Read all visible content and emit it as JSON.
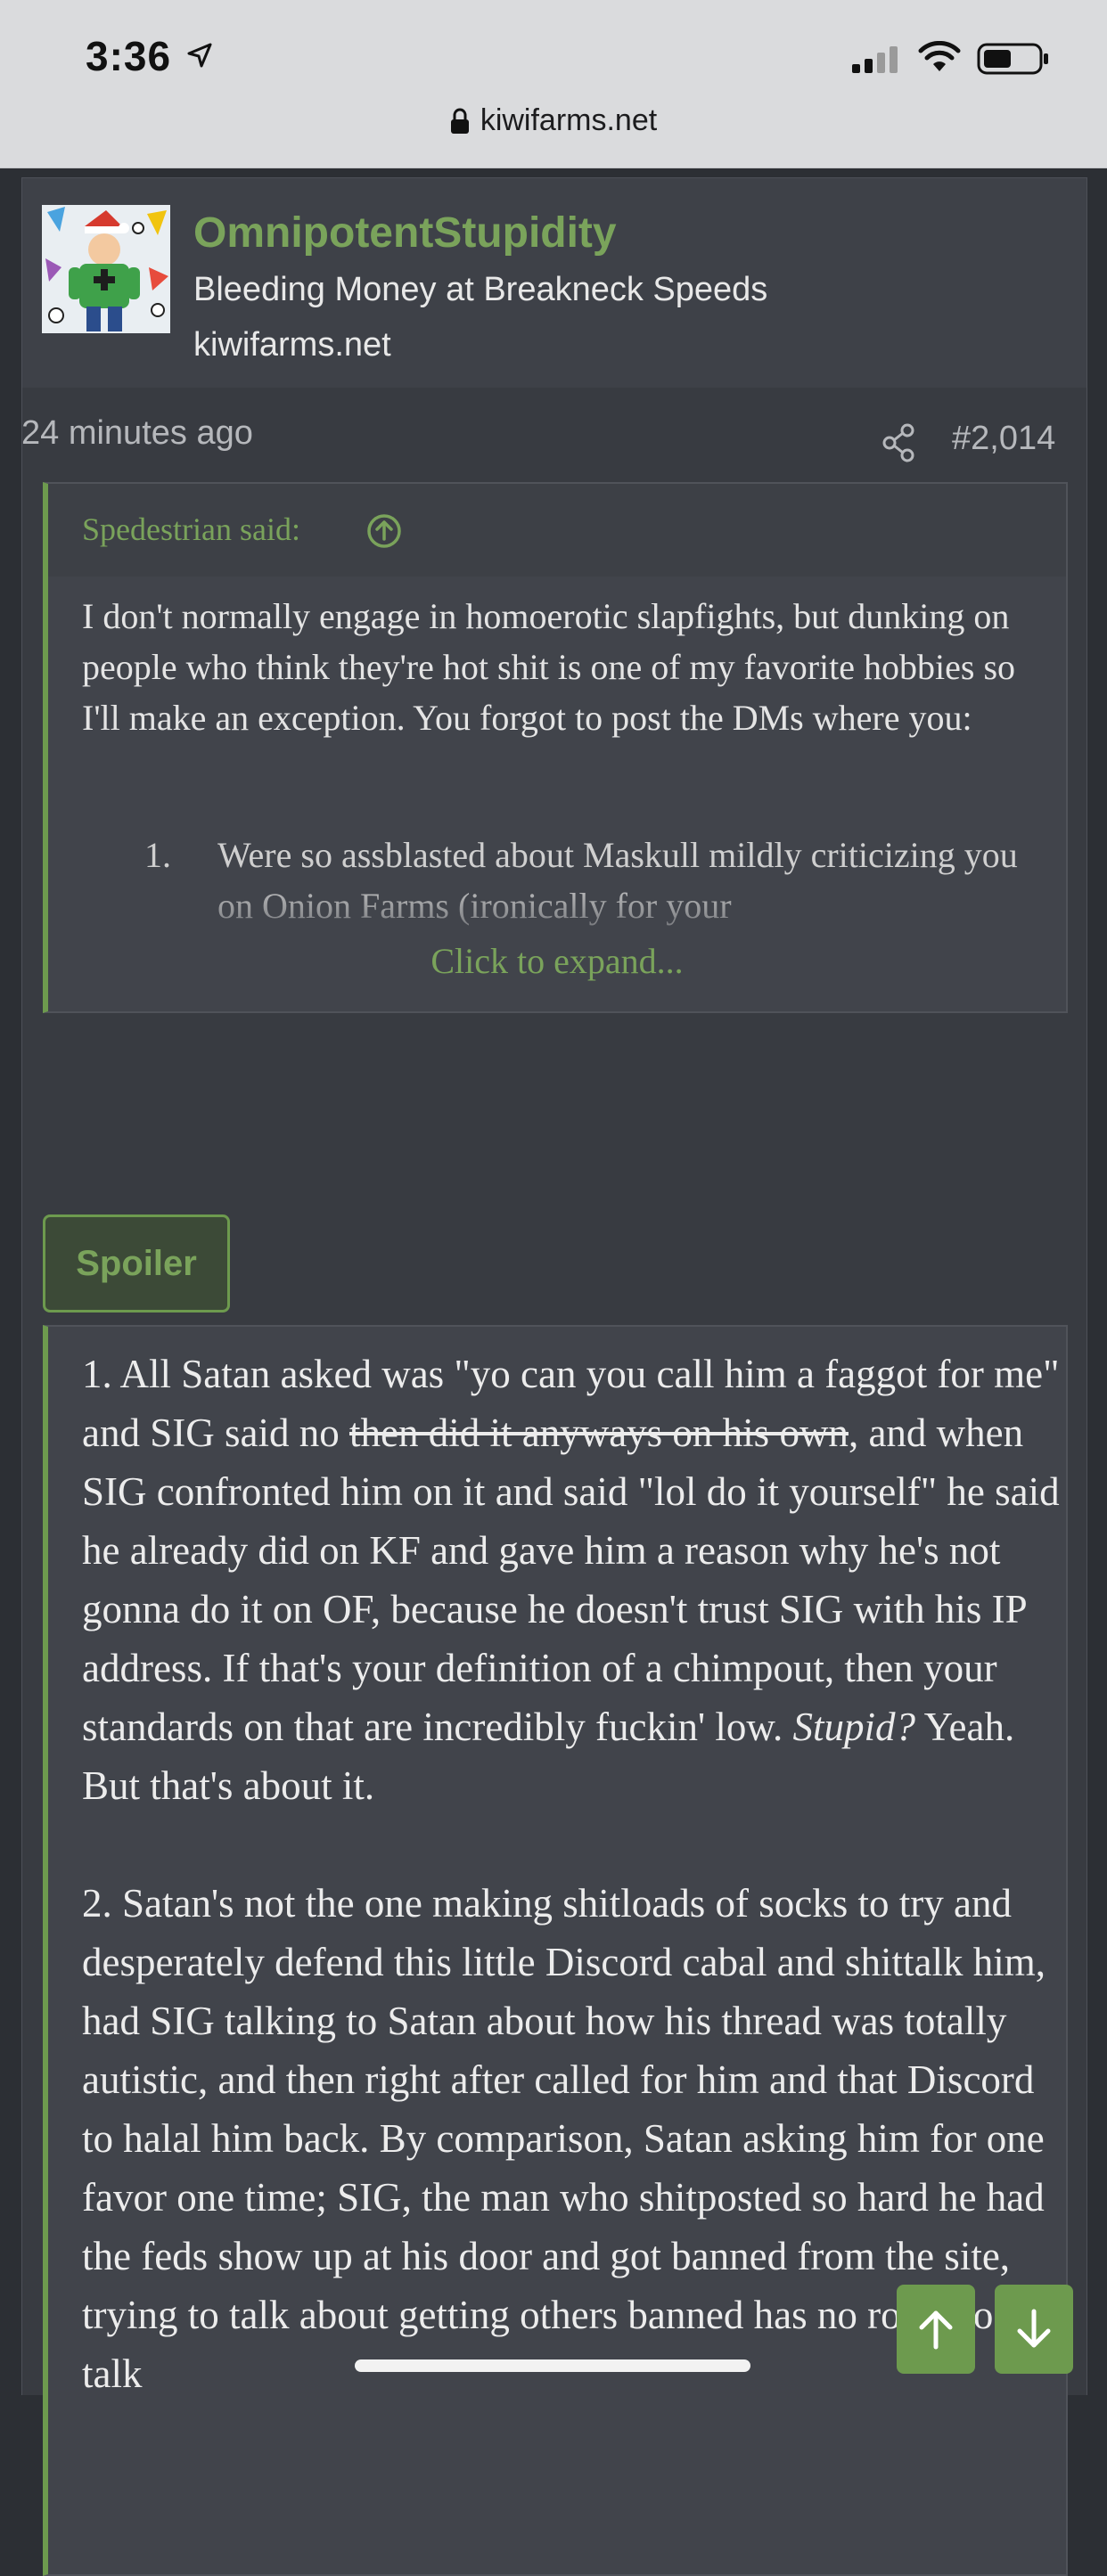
{
  "status_bar": {
    "time": "3:36",
    "url": "kiwifarms.net"
  },
  "user_card": {
    "username": "OmnipotentStupidity",
    "title": "Bleeding Money at Breakneck Speeds",
    "site": "kiwifarms.net"
  },
  "post": {
    "time": "24 minutes ago",
    "number": "#2,014"
  },
  "quote": {
    "attribution": "Spedestrian said:",
    "body": "I don't normally engage in homoerotic slapfights, but dunking on people who think they're hot shit is one of my favorite hobbies so I'll make an exception. You forgot to post the DMs where you:",
    "list_number": "1.",
    "list_text": "Were so assblasted about Maskull mildly criticizing you on Onion Farms (ironically for your",
    "expand_label": "Click to expand..."
  },
  "spoiler": {
    "button_label": "Spoiler",
    "p1_a": "1. All Satan asked was \"yo can you call him a faggot for me\" and SIG said no ",
    "p1_strike": "then did it anyways on his own",
    "p1_b": ", and when SIG confronted him on it and said \"lol do it yourself\" he said he already did on KF and gave him a reason why he's not gonna do it on OF, because he doesn't trust SIG with his IP address. If that's your definition of a chimpout, then your standards on that are incredibly fuckin' low. ",
    "p1_italic": "Stupid?",
    "p1_c": " Yeah. But that's about it.",
    "p2": "2. Satan's not the one making shitloads of socks to try and desperately defend this little Discord cabal and shittalk him, had SIG talking to Satan about how his thread was totally autistic, and then right after called for him and that Discord to halal him back. By comparison, Satan asking him for one favor one time; SIG, the man who shitposted so hard he had the feds show up at his door and got banned from the site, trying to talk about getting others banned has no room to talk"
  },
  "colors": {
    "accent_green": "#7aa35b",
    "background": "#2c2f34",
    "card": "#3e4148"
  },
  "icons": [
    "location-arrow-icon",
    "signal-icon",
    "wifi-icon",
    "battery-icon",
    "lock-icon",
    "share-icon",
    "arrow-up-circle-icon",
    "arrow-up-icon",
    "arrow-down-icon"
  ]
}
